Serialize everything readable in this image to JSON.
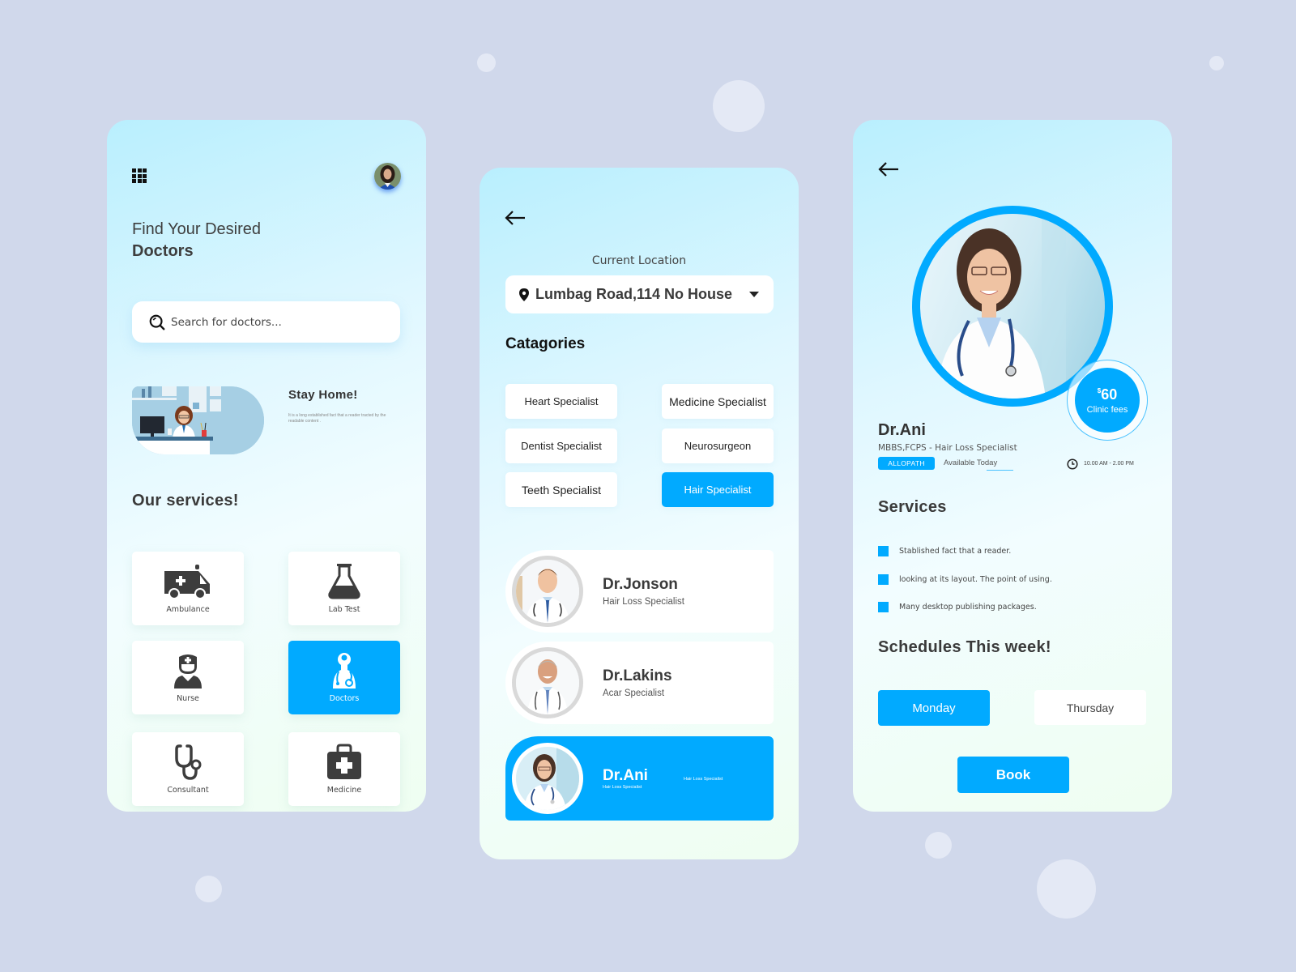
{
  "theme": {
    "accent": "#01aaff",
    "background": "#d0d8eb"
  },
  "home": {
    "menu_icon": "grid-menu-icon",
    "headline_line1": "Find Your Desired",
    "headline_line2": "Doctors",
    "search": {
      "placeholder": "Search for doctors...",
      "value": ""
    },
    "promo": {
      "title": "Stay Home!",
      "text": "It is a long established fact that a reader tracted by the readable content ."
    },
    "services_title": "Our services!",
    "services": [
      {
        "label": "Ambulance",
        "icon": "ambulance-icon",
        "active": false
      },
      {
        "label": "Lab Test",
        "icon": "flask-icon",
        "active": false
      },
      {
        "label": "Nurse",
        "icon": "nurse-icon",
        "active": false
      },
      {
        "label": "Doctors",
        "icon": "doctor-icon",
        "active": true
      },
      {
        "label": "Consultant",
        "icon": "stethoscope-icon",
        "active": false
      },
      {
        "label": "Medicine",
        "icon": "medical-kit-icon",
        "active": false
      }
    ]
  },
  "categories_screen": {
    "location_label": "Current Location",
    "location_value": "Lumbag Road,114 No House",
    "categories_title": "Catagories",
    "categories": [
      {
        "label": "Heart Specialist",
        "active": false
      },
      {
        "label": "Medicine Specialist",
        "active": false
      },
      {
        "label": "Dentist Specialist",
        "active": false
      },
      {
        "label": "Neurosurgeon",
        "active": false
      },
      {
        "label": "Teeth Specialist",
        "active": false
      },
      {
        "label": "Hair Specialist",
        "active": true
      }
    ],
    "doctors": [
      {
        "name": "Dr.Jonson",
        "specialty": "Hair Loss Specialist",
        "active": false
      },
      {
        "name": "Dr.Lakins",
        "specialty": "Acar Specialist",
        "active": false
      },
      {
        "name": "Dr.Ani",
        "specialty": "Hair Loss Specialist",
        "specialty_secondary": "Hair Loss Specialist",
        "active": true
      }
    ]
  },
  "profile": {
    "fee_currency": "$",
    "fee_amount": "60",
    "fee_label": "Clinic fees",
    "name": "Dr.Ani",
    "qualifications": "MBBS,FCPS - Hair Loss Specialist",
    "badge": "ALLOPATH",
    "availability": "Available Today",
    "hours": "10.00 AM - 2.00 PM",
    "services_title": "Services",
    "services": [
      "Stablished fact that a reader.",
      "looking at its layout. The point of using.",
      "Many desktop publishing packages."
    ],
    "schedule_title": "Schedules This week!",
    "days": [
      {
        "label": "Monday",
        "active": true
      },
      {
        "label": "Thursday",
        "active": false
      }
    ],
    "book_label": "Book"
  }
}
